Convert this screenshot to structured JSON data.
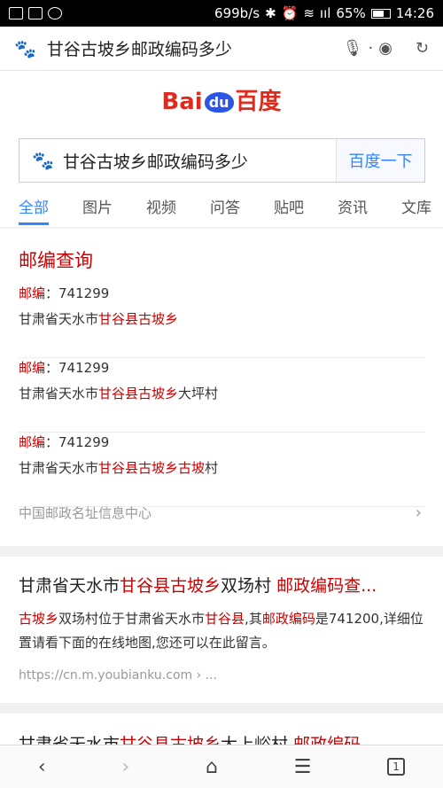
{
  "status": {
    "speed": "699b/s",
    "signal": "ııl",
    "battery": "65%",
    "time": "14:26"
  },
  "urlbar": {
    "query": "甘谷古坡乡邮政编码多少",
    "mic": "🎙",
    "dot": "·",
    "camera": "◉",
    "refresh": "↻",
    "paw": "🐾"
  },
  "logo": {
    "bai": "Bai",
    "du": "du",
    "bd": "百度"
  },
  "search": {
    "value": "甘谷古坡乡邮政编码多少",
    "button": "百度一下"
  },
  "tabs": [
    "全部",
    "图片",
    "视频",
    "问答",
    "贴吧",
    "资讯",
    "文库"
  ],
  "card1": {
    "title": "邮编查询",
    "entries": [
      {
        "label": "邮编",
        "code": "：741299",
        "prefix": "甘肃省天水市",
        "hl": "甘谷县古坡乡",
        "suffix": ""
      },
      {
        "label": "邮编",
        "code": "：741299",
        "prefix": "甘肃省天水市",
        "hl": "甘谷县古坡乡",
        "suffix": "大坪村"
      },
      {
        "label": "邮编",
        "code": "：741299",
        "prefix": "甘肃省天水市",
        "hl": "甘谷县古坡乡古坡",
        "suffix": "村"
      }
    ],
    "source": "中国邮政名址信息中心",
    "chevron": "›"
  },
  "card2": {
    "title_a": "甘肃省天水市",
    "title_hl": "甘谷县古坡乡",
    "title_b": "双场村 ",
    "title_hl2": "邮政编码查...",
    "desc_hl1": "古坡乡",
    "desc_a": "双场村位于甘肃省天水市",
    "desc_hl2": "甘谷县",
    "desc_b": ",其",
    "desc_hl3": "邮政编码",
    "desc_c": "是741200,详细位置请看下面的在线地图,您还可以在此留言。",
    "url": "https://cn.m.youbianku.com › ..."
  },
  "card3": {
    "title_a": "甘肃省天水市",
    "title_hl": "甘谷县古坡乡",
    "title_b": "大上峪村 ",
    "title_hl2": "邮政编码"
  },
  "nav": {
    "back": "‹",
    "forward": "›",
    "home": "⌂",
    "menu": "☰",
    "tabs": "1"
  }
}
